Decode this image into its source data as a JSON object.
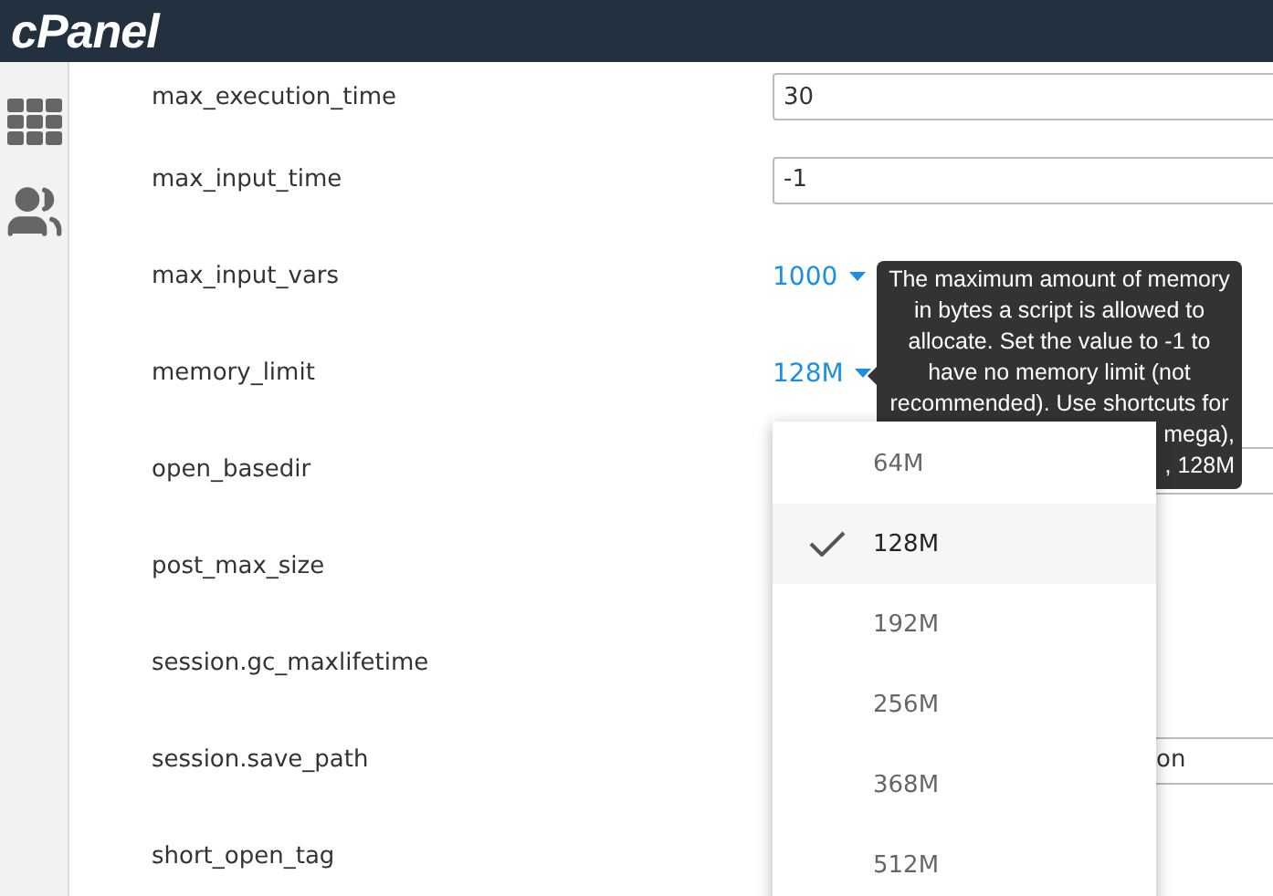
{
  "header": {
    "logo": "cPanel"
  },
  "sidebar": {
    "items": [
      {
        "kind": "grid"
      },
      {
        "kind": "users"
      }
    ]
  },
  "settings": [
    {
      "name": "max_execution_time",
      "kind": "input",
      "value": "30"
    },
    {
      "name": "max_input_time",
      "kind": "input",
      "value": "-1"
    },
    {
      "name": "max_input_vars",
      "kind": "select",
      "value": "1000"
    },
    {
      "name": "memory_limit",
      "kind": "select",
      "value": "128M"
    },
    {
      "name": "open_basedir",
      "kind": "covered-input"
    },
    {
      "name": "post_max_size",
      "kind": "hidden"
    },
    {
      "name": "session.gc_maxlifetime",
      "kind": "hidden"
    },
    {
      "name": "session.save_path",
      "kind": "covered-input",
      "value": "on"
    },
    {
      "name": "short_open_tag",
      "kind": "hidden"
    }
  ],
  "tooltip": {
    "lines": [
      {
        "kind": "line",
        "text": "The maximum amount of memory"
      },
      {
        "kind": "line",
        "text": "in bytes a script is allowed to"
      },
      {
        "kind": "line",
        "text": "allocate. Set the value to -1 to"
      },
      {
        "kind": "line",
        "text": "have no memory limit (not"
      },
      {
        "kind": "line",
        "text": "recommended). Use shortcuts for"
      },
      {
        "kind": "tail",
        "text": "mega),"
      },
      {
        "kind": "tail",
        "text": ", 128M"
      }
    ]
  },
  "dropdown": {
    "options": [
      {
        "label": "64M",
        "selected": false
      },
      {
        "label": "128M",
        "selected": true
      },
      {
        "label": "192M",
        "selected": false
      },
      {
        "label": "256M",
        "selected": false
      },
      {
        "label": "368M",
        "selected": false
      },
      {
        "label": "512M",
        "selected": false
      }
    ]
  }
}
